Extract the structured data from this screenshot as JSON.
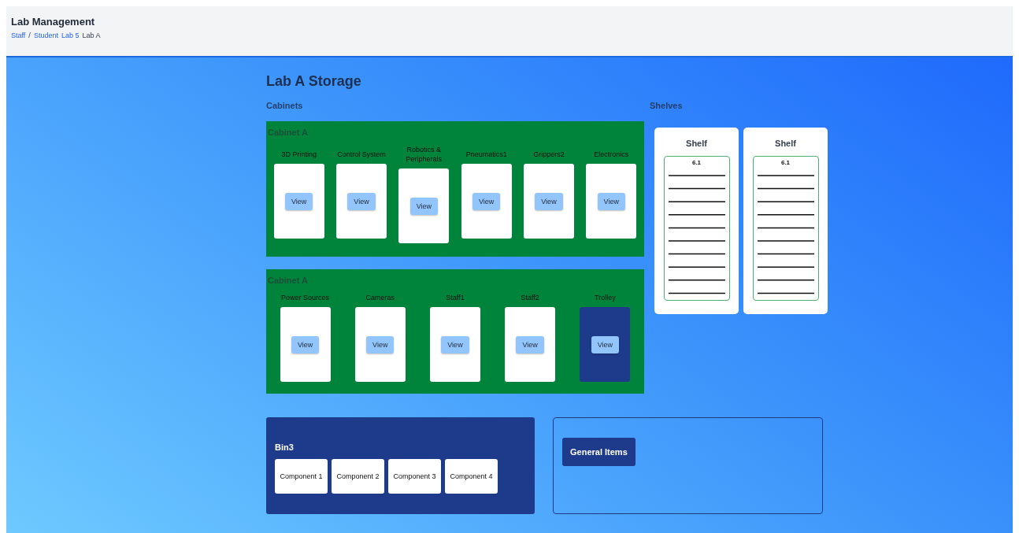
{
  "header": {
    "title": "Lab Management",
    "breadcrumb": [
      {
        "kind": "link",
        "text": "Staff"
      },
      {
        "kind": "separator",
        "text": "/"
      },
      {
        "kind": "link",
        "text": "Student"
      },
      {
        "kind": "link",
        "text": "Lab 5"
      },
      {
        "kind": "current",
        "text": "Lab A"
      }
    ]
  },
  "page_title": "Lab A Storage",
  "cabinets": {
    "heading": "Cabinets",
    "items": [
      {
        "title": "Cabinet A",
        "drawers": [
          {
            "label": "3D Printing",
            "button": "View",
            "highlighted": false
          },
          {
            "label": "Control System",
            "button": "View",
            "highlighted": false
          },
          {
            "label": "Robotics & Peripherals",
            "button": "View",
            "highlighted": false
          },
          {
            "label": "Pneumatics1",
            "button": "View",
            "highlighted": false
          },
          {
            "label": "Grippers2",
            "button": "View",
            "highlighted": false
          },
          {
            "label": "Electronics",
            "button": "View",
            "highlighted": false
          }
        ]
      },
      {
        "title": "Cabinet A",
        "drawers": [
          {
            "label": "Power Sources",
            "button": "View",
            "highlighted": false
          },
          {
            "label": "Cameras",
            "button": "View",
            "highlighted": false
          },
          {
            "label": "Staff1",
            "button": "View",
            "highlighted": false
          },
          {
            "label": "Staff2",
            "button": "View",
            "highlighted": false
          },
          {
            "label": "Trolley",
            "button": "View",
            "highlighted": true
          }
        ]
      }
    ]
  },
  "shelves": {
    "heading": "Shelves",
    "items": [
      {
        "title": "Shelf",
        "level_label": "6.1"
      },
      {
        "title": "Shelf",
        "level_label": "6.1"
      }
    ]
  },
  "bin": {
    "title": "Bin3",
    "components": [
      "Component 1",
      "Component 2",
      "Component 3",
      "Component 4"
    ]
  },
  "general": {
    "button": "General Items"
  }
}
